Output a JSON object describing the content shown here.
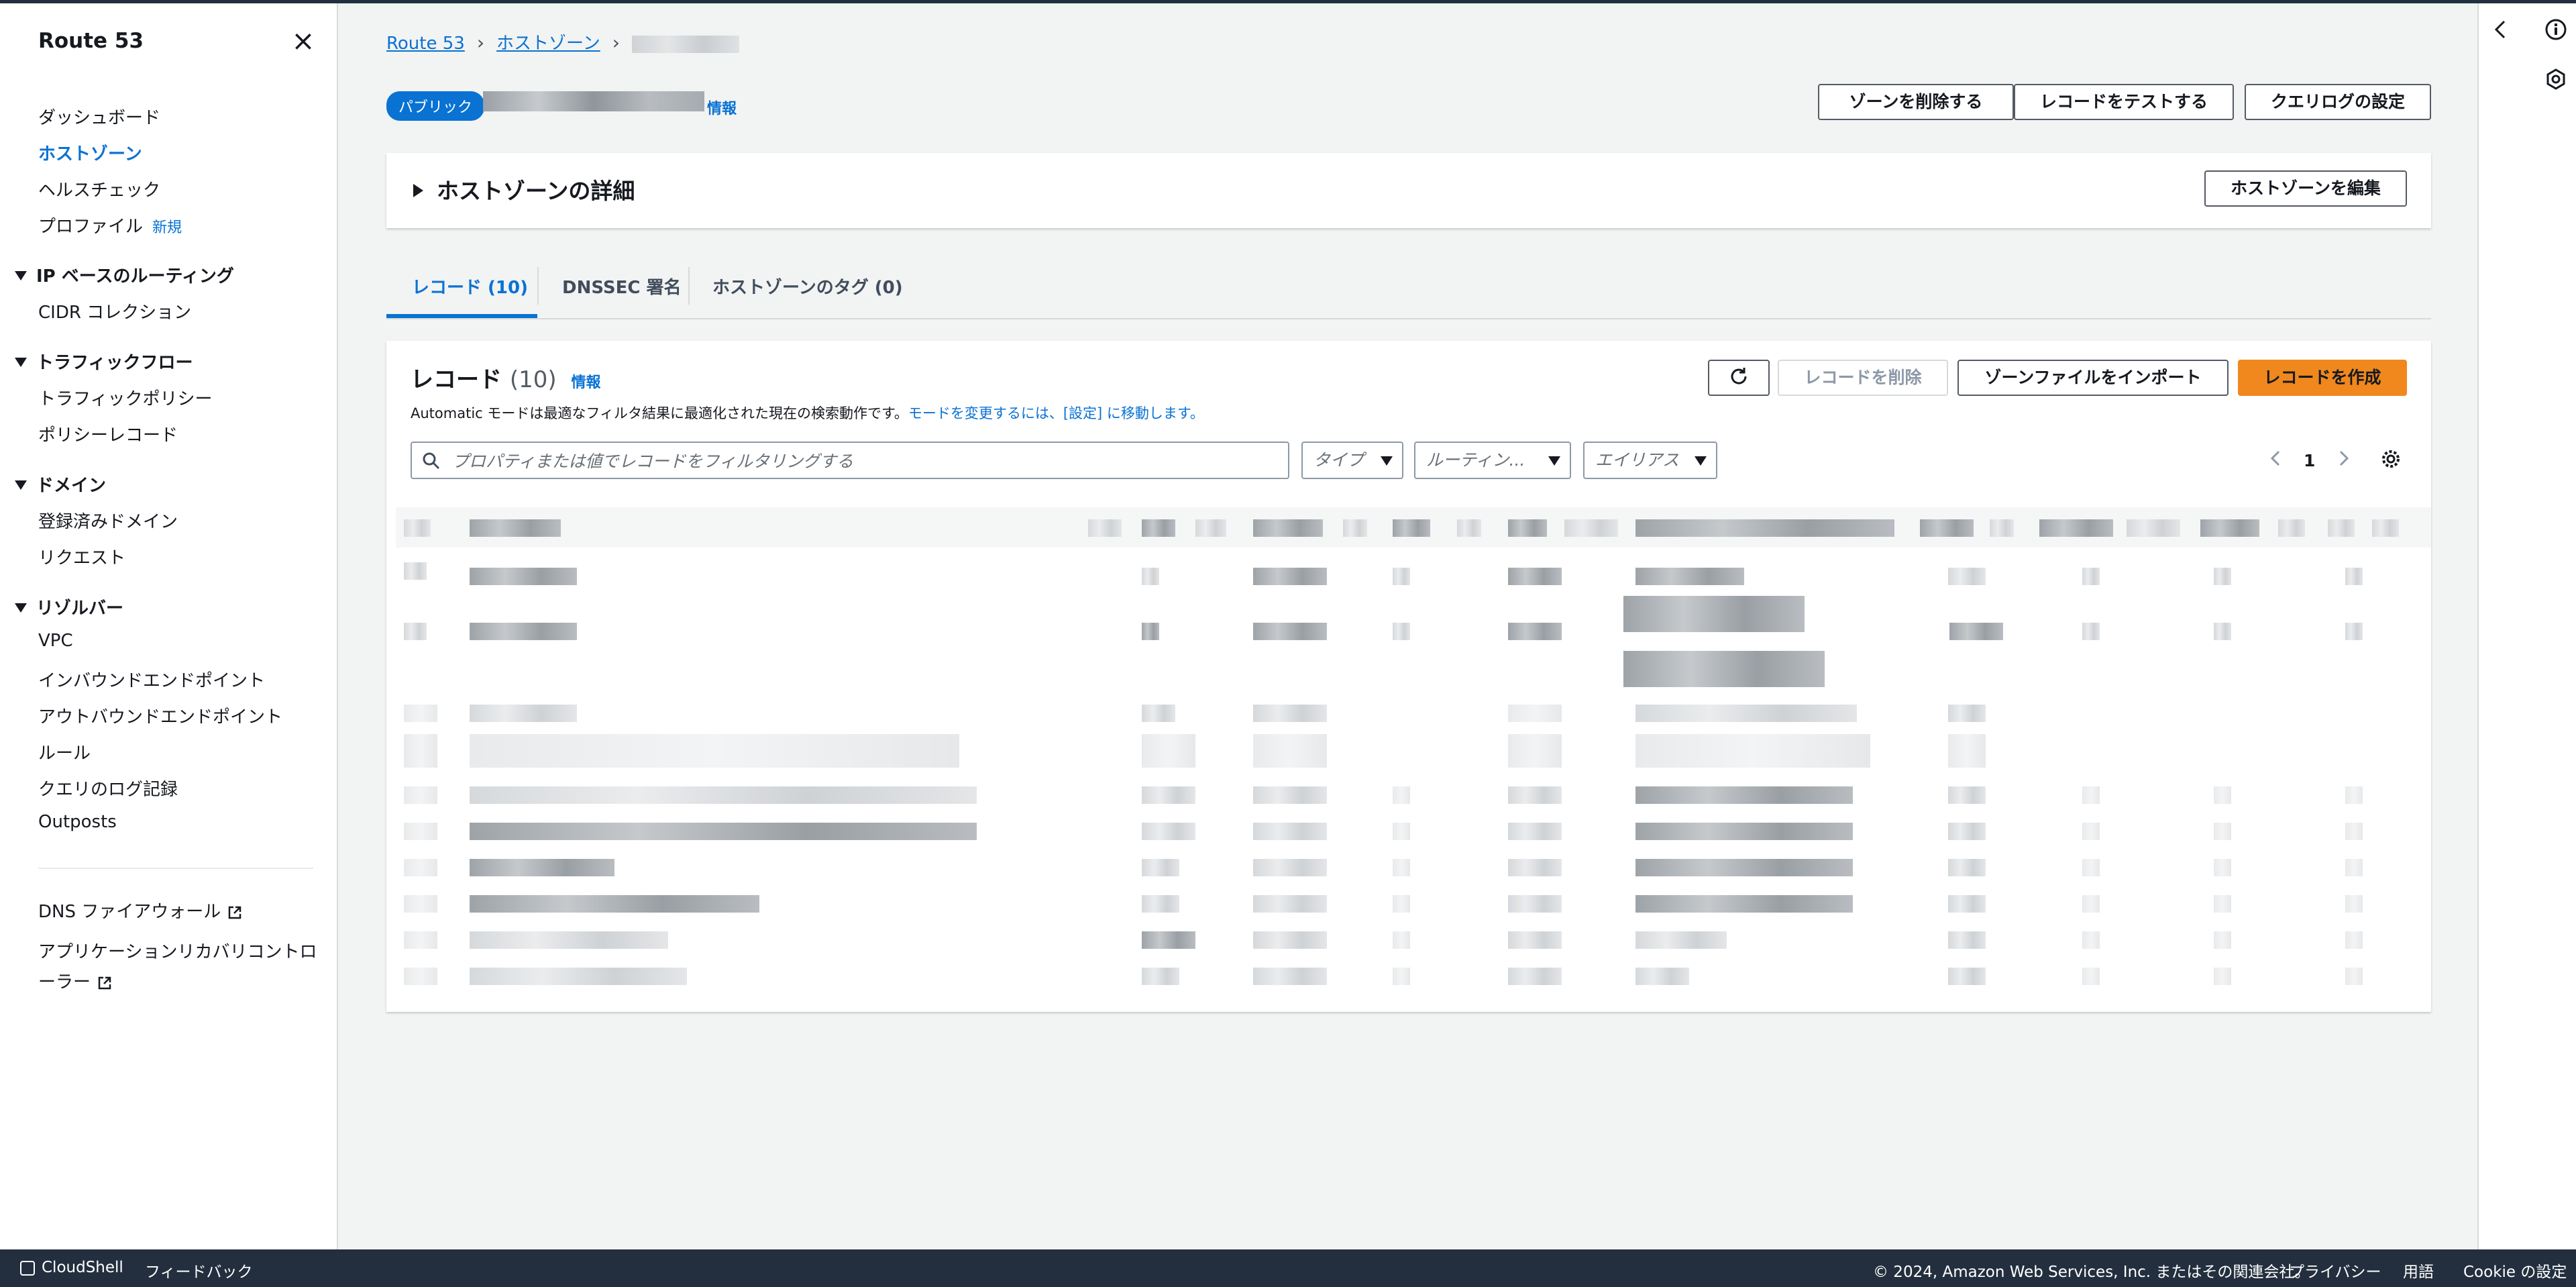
{
  "sidebar": {
    "title": "Route 53",
    "items": {
      "dashboard": "ダッシュボード",
      "hosted_zones": "ホストゾーン",
      "health_checks": "ヘルスチェック",
      "profiles": "プロファイル",
      "profiles_new": "新規"
    },
    "sections": {
      "ip_routing": "IP ベースのルーティング",
      "traffic_flow": "トラフィックフロー",
      "domains": "ドメイン",
      "resolver": "リゾルバー"
    },
    "ip_routing_items": [
      "CIDR コレクション"
    ],
    "traffic_flow_items": [
      "トラフィックポリシー",
      "ポリシーレコード"
    ],
    "domains_items": [
      "登録済みドメイン",
      "リクエスト"
    ],
    "resolver_items": [
      "VPC",
      "インバウンドエンドポイント",
      "アウトバウンドエンドポイント",
      "ルール",
      "クエリのログ記録",
      "Outposts"
    ],
    "external": {
      "dns_firewall": "DNS ファイアウォール",
      "arc_line1": "アプリケーションリカバリコントロ",
      "arc_line2": "ーラー"
    }
  },
  "breadcrumb": {
    "root": "Route 53",
    "hosted_zones": "ホストゾーン"
  },
  "header": {
    "badge": "パブリック",
    "info": "情報",
    "buttons": {
      "delete_zone": "ゾーンを削除する",
      "test_record": "レコードをテストする",
      "query_log": "クエリログの設定"
    }
  },
  "details": {
    "title": "ホストゾーンの詳細",
    "edit_button": "ホストゾーンを編集"
  },
  "tabs": {
    "records": "レコード (10)",
    "dnssec": "DNSSEC 署名",
    "tags": "ホストゾーンのタグ (0)"
  },
  "records_panel": {
    "title": "レコード",
    "count": "(10)",
    "info": "情報",
    "description": "Automatic モードは最適なフィルタ結果に最適化された現在の検索動作です。",
    "description_link": "モードを変更するには、[設定] に移動します。",
    "buttons": {
      "delete": "レコードを削除",
      "import": "ゾーンファイルをインポート",
      "create": "レコードを作成"
    },
    "search_placeholder": "プロパティまたは値でレコードをフィルタリングする",
    "filters": {
      "type": "タイプ",
      "routing": "ルーティン...",
      "alias": "エイリアス"
    },
    "page": "1"
  },
  "footer": {
    "cloudshell": "CloudShell",
    "feedback": "フィードバック",
    "copyright": "© 2024, Amazon Web Services, Inc. またはその関連会社。",
    "privacy": "プライバシー",
    "terms": "用語",
    "cookies": "Cookie の設定"
  },
  "colors": {
    "accent": "#0972d3",
    "primary_button": "#f0881e",
    "footer_bg": "#232f3e"
  }
}
